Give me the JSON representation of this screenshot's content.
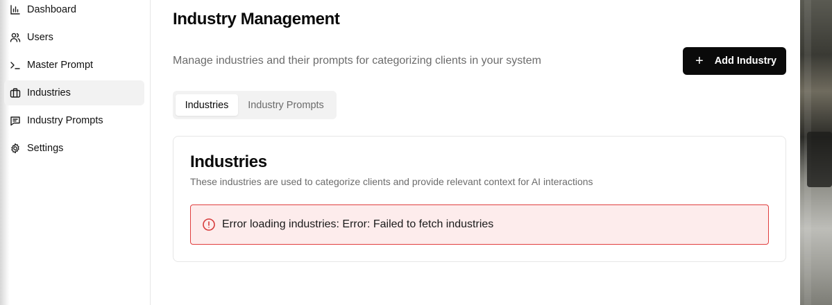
{
  "sidebar": {
    "items": [
      {
        "label": "Dashboard",
        "icon": "bar-chart-icon",
        "active": false
      },
      {
        "label": "Users",
        "icon": "users-icon",
        "active": false
      },
      {
        "label": "Master Prompt",
        "icon": "terminal-icon",
        "active": false
      },
      {
        "label": "Industries",
        "icon": "briefcase-icon",
        "active": true
      },
      {
        "label": "Industry Prompts",
        "icon": "message-icon",
        "active": false
      },
      {
        "label": "Settings",
        "icon": "gear-icon",
        "active": false
      }
    ]
  },
  "header": {
    "title": "Industry Management",
    "description": "Manage industries and their prompts for categorizing clients in your system",
    "add_button_label": "Add Industry"
  },
  "tabs": [
    {
      "label": "Industries",
      "active": true
    },
    {
      "label": "Industry Prompts",
      "active": false
    }
  ],
  "card": {
    "title": "Industries",
    "description": "These industries are used to categorize clients and provide relevant context for AI interactions",
    "error_message": "Error loading industries: Error: Failed to fetch industries"
  },
  "colors": {
    "primary_button": "#0a0a0a",
    "error_border": "#e03d3d",
    "error_background": "#fdecec",
    "active_nav_background": "#f2f2f2"
  }
}
